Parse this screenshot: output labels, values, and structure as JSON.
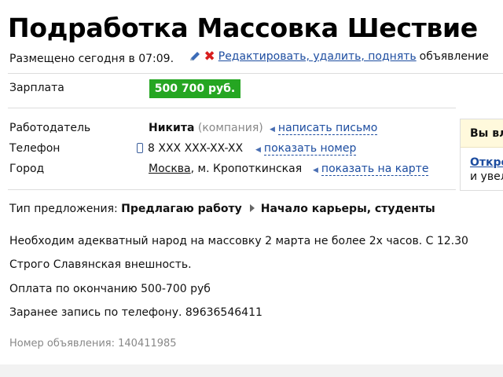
{
  "page_title": "Подработка Массовка Шествие",
  "meta": {
    "posted": "Размещено сегодня в 07:09.",
    "actions_link": "Редактировать, удалить, поднять",
    "actions_suffix": "объявление"
  },
  "salary": {
    "label": "Зарплата",
    "value": "500 700 руб."
  },
  "employer": {
    "label": "Работодатель",
    "name": "Никита",
    "type": "(компания)",
    "action": "написать письмо"
  },
  "phone": {
    "label": "Телефон",
    "value": "8 XXX XXX-XX-XX",
    "action": "показать номер"
  },
  "city": {
    "label": "Город",
    "name": "Москва",
    "metro": ", м. Кропоткинская",
    "action": "показать на карте"
  },
  "side_panel": {
    "header": "Вы вл",
    "link": "Откро",
    "text": "и увел"
  },
  "offer": {
    "label": "Тип предложения:",
    "type": "Предлагаю работу",
    "category": "Начало карьеры, студенты"
  },
  "description": [
    "Необходим адекватный народ на массовку 2 марта не более 2х часов. С 12.30",
    "Строго Славянская внешность.",
    "Оплата по окончанию 500-700 руб",
    "Заранее запись по телефону. 89636546411"
  ],
  "ad_number": "Номер объявления: 140411985",
  "colors": {
    "salary_badge": "#25a622",
    "link": "#1d4da0",
    "delete_icon": "#d81e1e"
  }
}
